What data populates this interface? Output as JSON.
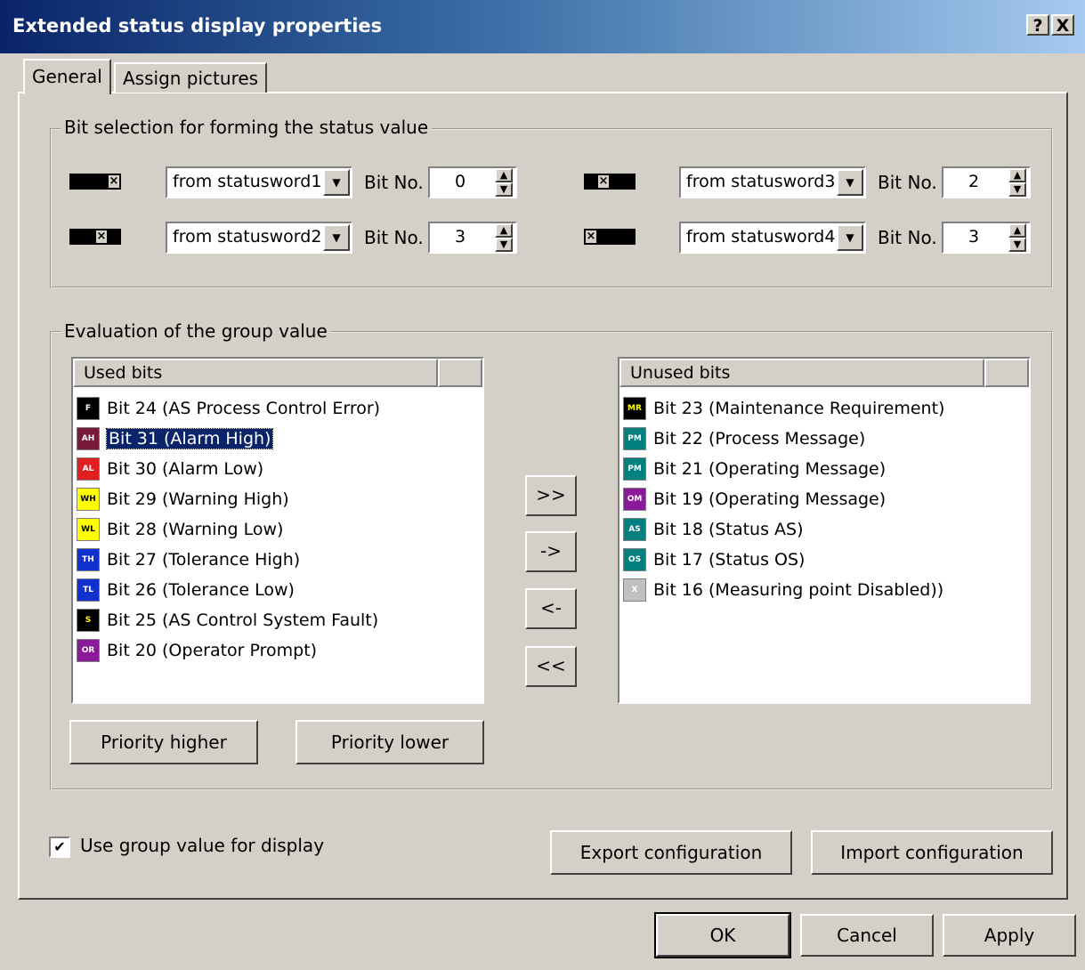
{
  "window": {
    "title": "Extended status display properties",
    "help_label": "?",
    "close_label": "X"
  },
  "tabs": [
    {
      "label": "General"
    },
    {
      "label": "Assign pictures"
    }
  ],
  "bit_selection": {
    "legend": "Bit selection for forming the status value",
    "rows": [
      {
        "source": "from statusword1",
        "bit_label": "Bit No.",
        "bit_value": "0"
      },
      {
        "source": "from statusword2",
        "bit_label": "Bit No.",
        "bit_value": "3"
      },
      {
        "source": "from statusword3",
        "bit_label": "Bit No.",
        "bit_value": "2"
      },
      {
        "source": "from statusword4",
        "bit_label": "Bit No.",
        "bit_value": "3"
      }
    ],
    "pattern_mark": "×"
  },
  "evaluation": {
    "legend": "Evaluation of the group value",
    "used_header": "Used bits",
    "unused_header": "Unused bits",
    "used_bits": [
      {
        "badge": "F",
        "label": "Bit 24 (AS Process Control Error)",
        "color": "#000000",
        "fg": "#ffffff"
      },
      {
        "badge": "AH",
        "label": "Bit 31 (Alarm High)",
        "color": "#7a1a3a",
        "fg": "#ffffff"
      },
      {
        "badge": "AL",
        "label": "Bit 30 (Alarm Low)",
        "color": "#e02020",
        "fg": "#ffffff"
      },
      {
        "badge": "WH",
        "label": "Bit 29 (Warning High)",
        "color": "#ffff00",
        "fg": "#000000"
      },
      {
        "badge": "WL",
        "label": "Bit 28 (Warning Low)",
        "color": "#ffff00",
        "fg": "#000000"
      },
      {
        "badge": "TH",
        "label": "Bit 27 (Tolerance High)",
        "color": "#1030d0",
        "fg": "#ffffff"
      },
      {
        "badge": "TL",
        "label": "Bit 26 (Tolerance Low)",
        "color": "#1030d0",
        "fg": "#ffffff"
      },
      {
        "badge": "S",
        "label": "Bit 25 (AS Control System Fault)",
        "color": "#000000",
        "fg": "#ffff00"
      },
      {
        "badge": "OR",
        "label": "Bit 20 (Operator Prompt)",
        "color": "#8a1a9a",
        "fg": "#ffffff"
      }
    ],
    "unused_bits": [
      {
        "badge": "MR",
        "label": "Bit 23 (Maintenance Requirement)",
        "color": "#000000",
        "fg": "#ffff00"
      },
      {
        "badge": "PM",
        "label": "Bit 22 (Process Message)",
        "color": "#008080",
        "fg": "#ffffff"
      },
      {
        "badge": "PM",
        "label": "Bit 21 (Operating Message)",
        "color": "#008080",
        "fg": "#ffffff"
      },
      {
        "badge": "OM",
        "label": "Bit 19 (Operating Message)",
        "color": "#8a1a9a",
        "fg": "#ffffff"
      },
      {
        "badge": "AS",
        "label": "Bit 18 (Status AS)",
        "color": "#008080",
        "fg": "#ffffff"
      },
      {
        "badge": "OS",
        "label": "Bit 17 (Status OS)",
        "color": "#008080",
        "fg": "#ffffff"
      },
      {
        "badge": "X",
        "label": "Bit 16 (Measuring point Disabled))",
        "color": "#c0c0c0",
        "fg": "#ffffff"
      }
    ],
    "move_buttons": [
      ">>",
      "->",
      "<-",
      "<<"
    ],
    "priority_higher": "Priority higher",
    "priority_lower": "Priority lower"
  },
  "use_group_value": {
    "label": "Use group value for display",
    "checked": true,
    "check_mark": "✔"
  },
  "export_button": "Export configuration",
  "import_button": "Import configuration",
  "footer": {
    "ok": "OK",
    "cancel": "Cancel",
    "apply": "Apply"
  }
}
